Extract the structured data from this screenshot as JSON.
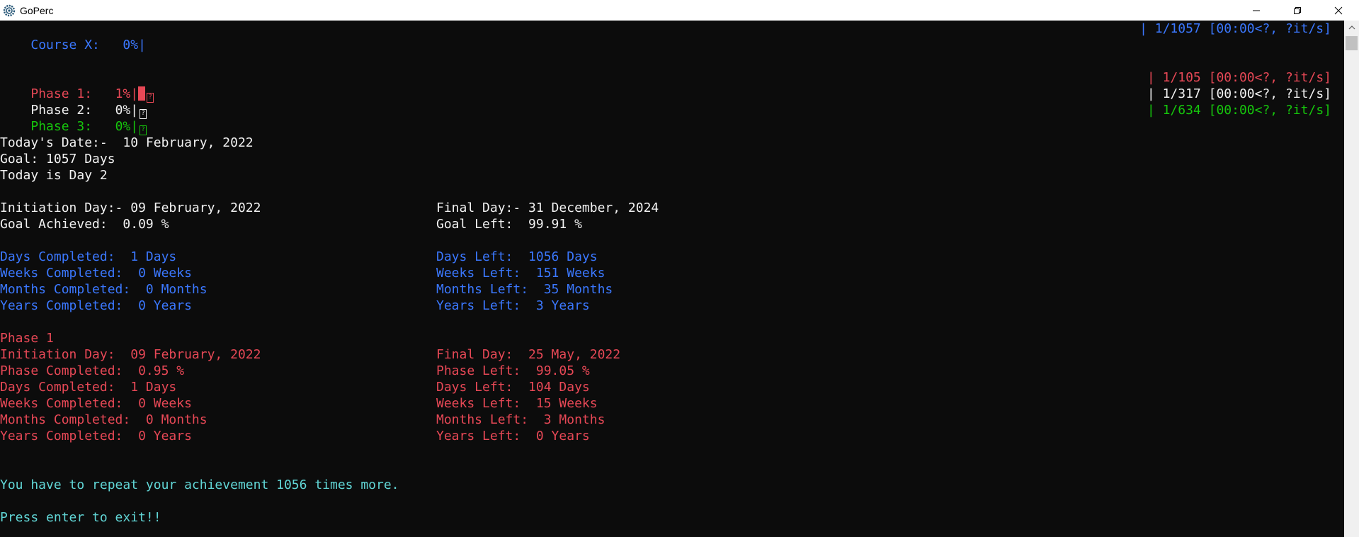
{
  "window": {
    "title": "GoPerc",
    "icon": "gear-icon",
    "controls": [
      "minimize-icon",
      "restore-icon",
      "close-icon"
    ]
  },
  "progress": {
    "course": {
      "label": "Course X:",
      "percent": "0%",
      "sep": "|",
      "stats": "| 1/1057 [00:00<?, ?it/s]",
      "color": "#3b78ff"
    },
    "phases": [
      {
        "label": "Phase 1:",
        "percent": "1%",
        "sep": "|",
        "stats": "| 1/105 [00:00<?, ?it/s]",
        "color": "#e74856",
        "fill": 0.01
      },
      {
        "label": "Phase 2:",
        "percent": "0%",
        "sep": "|",
        "stats": "| 1/317 [00:00<?, ?it/s]",
        "color": "#f2f2f2",
        "fill": 0
      },
      {
        "label": "Phase 3:",
        "percent": "0%",
        "sep": "|",
        "stats": "| 1/634 [00:00<?, ?it/s]",
        "color": "#16c60c",
        "fill": 0
      }
    ]
  },
  "summary": {
    "today": "Today's Date:-  10 February, 2022",
    "goal": "Goal: 1057 Days",
    "day": "Today is Day 2"
  },
  "overall": {
    "initiation": "Initiation Day:- 09 February, 2022",
    "final": "Final Day:- 31 December, 2024",
    "achieved": "Goal Achieved:  0.09 %",
    "left": "Goal Left:  99.91 %",
    "days_completed": "Days Completed:  1 Days",
    "days_left": "Days Left:  1056 Days",
    "weeks_completed": "Weeks Completed:  0 Weeks",
    "weeks_left": "Weeks Left:  151 Weeks",
    "months_completed": "Months Completed:  0 Months",
    "months_left": "Months Left:  35 Months",
    "years_completed": "Years Completed:  0 Years",
    "years_left": "Years Left:  3 Years"
  },
  "phase1": {
    "title": "Phase 1",
    "initiation": "Initiation Day:  09 February, 2022",
    "final": "Final Day:  25 May, 2022",
    "completed": "Phase Completed:  0.95 %",
    "left": "Phase Left:  99.05 %",
    "days_completed": "Days Completed:  1 Days",
    "days_left": "Days Left:  104 Days",
    "weeks_completed": "Weeks Completed:  0 Weeks",
    "weeks_left": "Weeks Left:  15 Weeks",
    "months_completed": "Months Completed:  0 Months",
    "months_left": "Months Left:  3 Months",
    "years_completed": "Years Completed:  0 Years",
    "years_left": "Years Left:  0 Years"
  },
  "footer": {
    "repeat": "You have to repeat your achievement 1056 times more.",
    "exit": "Press enter to exit!!"
  }
}
